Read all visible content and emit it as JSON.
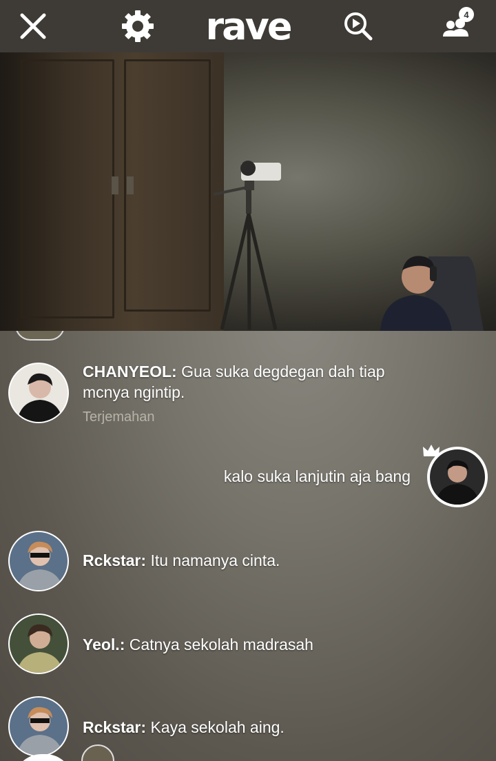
{
  "header": {
    "logo_text": "rave",
    "user_count": "4"
  },
  "messages": [
    {
      "user": "CHANYEOL:",
      "text": "Gua suka degdegan dah tiap mcnya ngintip.",
      "translate_label": "Terjemahan"
    },
    {
      "self": true,
      "text": "kalo suka lanjutin aja bang"
    },
    {
      "user": "Rckstar:",
      "text": "Itu namanya cinta."
    },
    {
      "user": "Yeol.:",
      "text": "Catnya sekolah madrasah"
    },
    {
      "user": "Rckstar:",
      "text": "Kaya sekolah aing."
    }
  ],
  "colors": {
    "topbar": "#3e3b36",
    "accent_white": "#ffffff"
  }
}
